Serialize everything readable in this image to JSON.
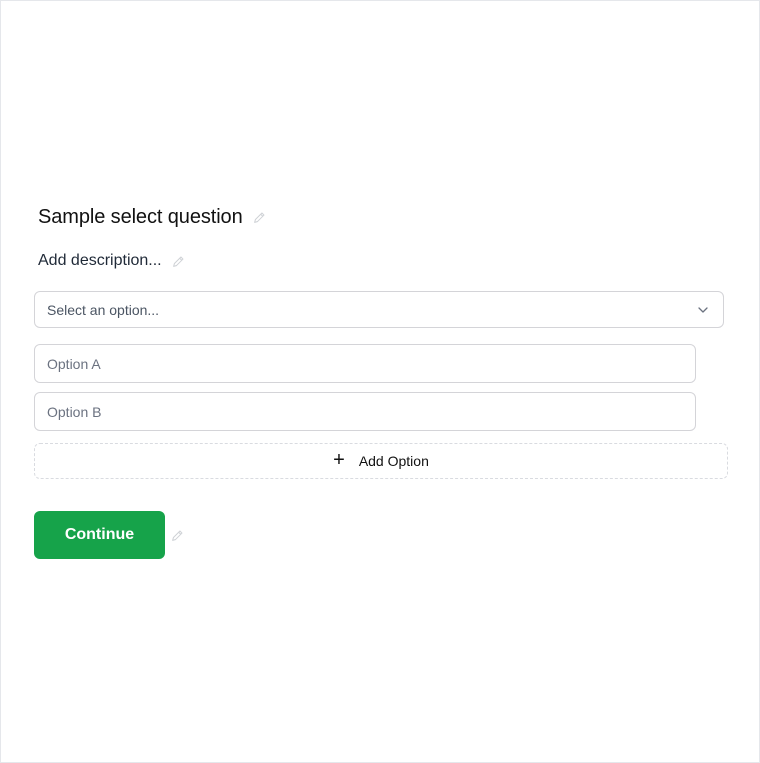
{
  "question": {
    "title": "Sample select question",
    "description": "Add description..."
  },
  "select": {
    "placeholder": "Select an option..."
  },
  "options": [
    {
      "placeholder": "Option A"
    },
    {
      "placeholder": "Option B"
    }
  ],
  "add_option": {
    "label": "Add Option",
    "icon": "+"
  },
  "continue_button": {
    "label": "Continue"
  },
  "colors": {
    "accent": "#16a34a",
    "border": "#d4d4d8",
    "text": "#111111"
  },
  "icons": {
    "edit": "pencil-icon",
    "dropdown": "chevron-down-icon",
    "add": "plus-icon"
  }
}
